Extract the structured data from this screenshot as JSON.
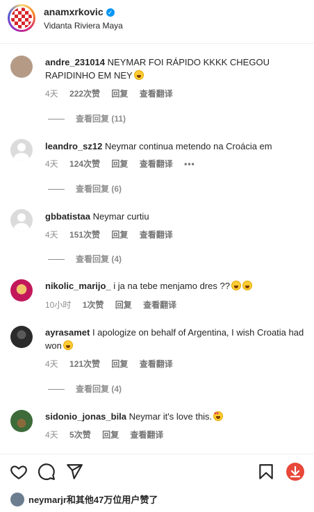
{
  "header": {
    "username": "anamxrkovic",
    "location": "Vidanta Riviera Maya"
  },
  "comments": [
    {
      "username": "andre_231014",
      "text": "NEYMAR FOI RÁPIDO KKKK CHEGOU RAPIDINHO EM NEY",
      "emoji": "laughing-emoji",
      "time": "4天",
      "likes": "222次赞",
      "reply": "回复",
      "translate": "查看翻译",
      "view_replies": "查看回复 (11)",
      "avatar_color": "#b59b86"
    },
    {
      "username": "leandro_sz12",
      "text": "Neymar continua metendo na Croácia em",
      "time": "4天",
      "likes": "124次赞",
      "reply": "回复",
      "translate": "查看翻译",
      "more": "•••",
      "view_replies": "查看回复 (6)",
      "avatar_color": "#dbdbdb"
    },
    {
      "username": "gbbatistaa",
      "text": "Neymar curtiu",
      "time": "4天",
      "likes": "151次赞",
      "reply": "回复",
      "translate": "查看翻译",
      "view_replies": "查看回复 (4)",
      "avatar_color": "#dbdbdb"
    },
    {
      "username": "nikolic_marijo_",
      "text": "i ja na tebe menjamo dres ??",
      "emoji": "laughing-emoji x2",
      "time": "10小时",
      "likes": "1次赞",
      "reply": "回复",
      "translate": "查看翻译",
      "avatar_color": "#c2185b"
    },
    {
      "username": "ayrasamet",
      "text": "I apologize on behalf of Argentina, I wish Croatia had won",
      "emoji": "laughing-emoji",
      "time": "4天",
      "likes": "121次赞",
      "reply": "回复",
      "translate": "查看翻译",
      "view_replies": "查看回复 (4)",
      "avatar_color": "#2b2b2b"
    },
    {
      "username": "sidonio_jonas_bila",
      "text": "Neymar it's love this.",
      "emoji": "heart-eyes-emoji",
      "time": "4天",
      "likes": "5次赞",
      "reply": "回复",
      "translate": "查看翻译",
      "avatar_color": "#3d6b3a"
    }
  ],
  "liked_by": "neymarjr和其他47万位用户赞了",
  "colors": {
    "verified": "#0095f6",
    "save": "#e8473a",
    "meta": "#8e8e8e"
  }
}
